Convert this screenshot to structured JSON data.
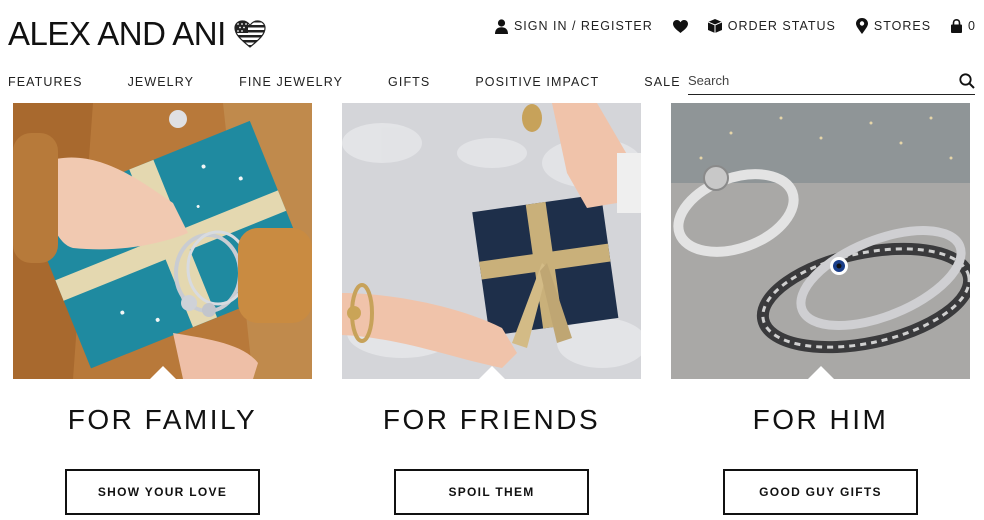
{
  "header": {
    "brand": "ALEX AND ANI",
    "utility": {
      "sign_in": "SIGN IN / REGISTER",
      "order_status": "ORDER STATUS",
      "stores": "STORES",
      "cart_count": "0"
    }
  },
  "nav": {
    "items": [
      "FEATURES",
      "JEWELRY",
      "FINE JEWELRY",
      "GIFTS",
      "POSITIVE IMPACT",
      "SALE"
    ]
  },
  "search": {
    "placeholder": "Search"
  },
  "cards": [
    {
      "title": "FOR FAMILY",
      "button": "SHOW YOUR LOVE"
    },
    {
      "title": "FOR FRIENDS",
      "button": "SPOIL THEM"
    },
    {
      "title": "FOR HIM",
      "button": "GOOD GUY GIFTS"
    }
  ],
  "icons": {
    "logo_heart": "flag-heart-icon",
    "user": "user-icon",
    "wishlist": "heart-icon",
    "order": "box-icon",
    "stores": "map-pin-icon",
    "cart": "lock-bag-icon",
    "search": "search-icon"
  }
}
